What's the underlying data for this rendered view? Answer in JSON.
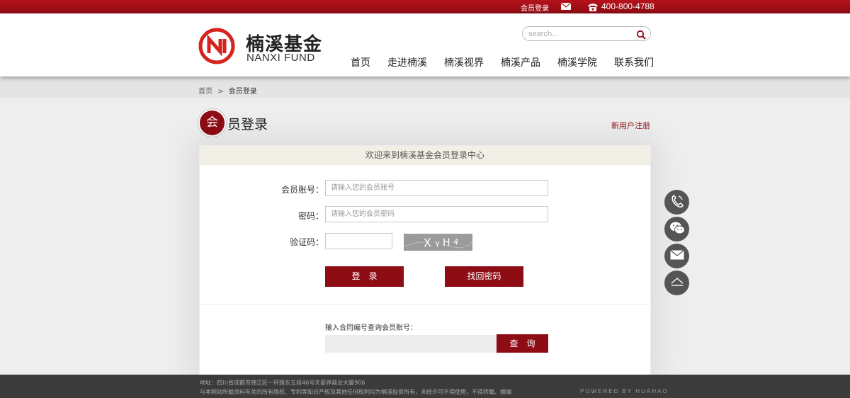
{
  "topbar": {
    "login_label": "会员登录",
    "phone": "400-800-4788",
    "mail_icon": "mail-icon",
    "phone_icon": "phone-icon"
  },
  "header": {
    "logo_cn": "楠溪基金",
    "logo_en": "NANXI FUND",
    "search_placeholder": "search...",
    "nav": [
      "首页",
      "走进楠溪",
      "楠溪视界",
      "楠溪产品",
      "楠溪学院",
      "联系我们"
    ]
  },
  "breadcrumb": {
    "home": "首页",
    "separator": ">",
    "current": "会员登录"
  },
  "page": {
    "title_circle": "会",
    "title_rest": "员登录",
    "register_link": "新用户注册"
  },
  "panel": {
    "heading": "欢迎来到楠溪基金会员登录中心",
    "account_label": "会员账号：",
    "account_placeholder": "请输入您的会员账号",
    "password_label": "密码：",
    "password_placeholder": "请输入您的会员密码",
    "captcha_label": "验证码：",
    "captcha_text": "XYH4",
    "login_button": "登　录",
    "recover_button": "找回密码",
    "query_label": "输入合同编号查询会员账号：",
    "query_button": "查　询"
  },
  "side_buttons": [
    "phone-icon",
    "wechat-icon",
    "mail-icon",
    "back-to-top-icon"
  ],
  "footer": {
    "address": "地址：四川省成都市锦江区一环路东五段46号天豪界商业大厦906",
    "copyright": "与本网站所载资料有关的所有版权、专利等知识产权及其他任何权利均为楠溪投资所有，未经许可不得使用，不得转载、摘编",
    "powered": "POWERED BY HUAHAO"
  },
  "colors": {
    "brand": "#8e0c14",
    "topbar": "#b5121b",
    "footer": "#3b3b3b"
  }
}
